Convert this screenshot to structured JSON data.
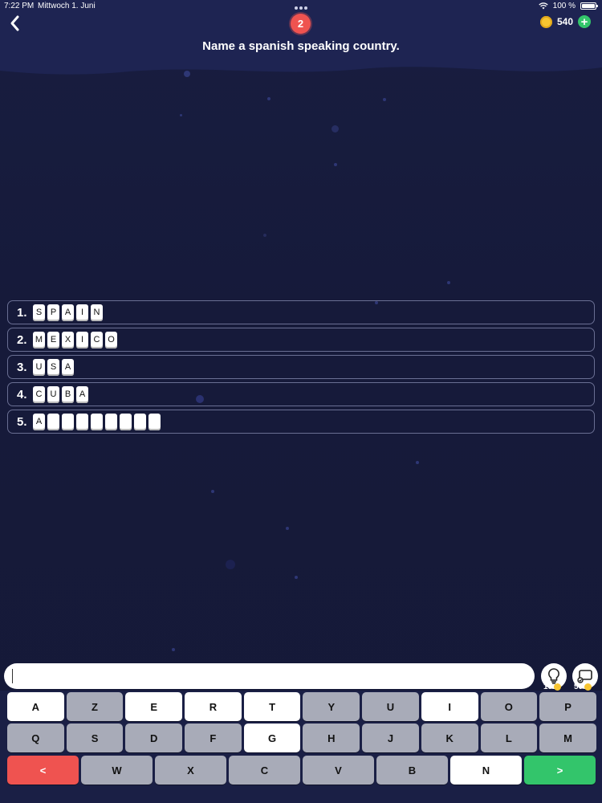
{
  "status": {
    "time": "7:22 PM",
    "date": "Mittwoch 1. Juni",
    "battery": "100 %"
  },
  "header": {
    "level": "2",
    "coins": "540",
    "question": "Name a spanish speaking country."
  },
  "answers": [
    {
      "num": "1.",
      "letters": [
        "S",
        "P",
        "A",
        "I",
        "N"
      ]
    },
    {
      "num": "2.",
      "letters": [
        "M",
        "E",
        "X",
        "I",
        "C",
        "O"
      ]
    },
    {
      "num": "3.",
      "letters": [
        "U",
        "S",
        "A"
      ]
    },
    {
      "num": "4.",
      "letters": [
        "C",
        "U",
        "B",
        "A"
      ]
    },
    {
      "num": "5.",
      "letters": [
        "A",
        "",
        "",
        "",
        "",
        "",
        "",
        "",
        ""
      ]
    }
  ],
  "input": {
    "value": ""
  },
  "aids": {
    "hint_cost": "10",
    "reveal_cost": "50"
  },
  "keyboard": {
    "row1": [
      {
        "label": "A",
        "state": "available"
      },
      {
        "label": "Z",
        "state": "used"
      },
      {
        "label": "E",
        "state": "available"
      },
      {
        "label": "R",
        "state": "available"
      },
      {
        "label": "T",
        "state": "available"
      },
      {
        "label": "Y",
        "state": "used"
      },
      {
        "label": "U",
        "state": "used"
      },
      {
        "label": "I",
        "state": "available"
      },
      {
        "label": "O",
        "state": "used"
      },
      {
        "label": "P",
        "state": "used"
      }
    ],
    "row2": [
      {
        "label": "Q",
        "state": "used"
      },
      {
        "label": "S",
        "state": "used"
      },
      {
        "label": "D",
        "state": "used"
      },
      {
        "label": "F",
        "state": "used"
      },
      {
        "label": "G",
        "state": "available"
      },
      {
        "label": "H",
        "state": "used"
      },
      {
        "label": "J",
        "state": "used"
      },
      {
        "label": "K",
        "state": "used"
      },
      {
        "label": "L",
        "state": "used"
      },
      {
        "label": "M",
        "state": "used"
      }
    ],
    "row3": [
      {
        "label": "W",
        "state": "used"
      },
      {
        "label": "X",
        "state": "used"
      },
      {
        "label": "C",
        "state": "used"
      },
      {
        "label": "V",
        "state": "used"
      },
      {
        "label": "B",
        "state": "used"
      },
      {
        "label": "N",
        "state": "available"
      }
    ],
    "delete_label": "<",
    "submit_label": ">"
  },
  "colors": {
    "background": "#161a3a",
    "accent_red": "#ef5350",
    "accent_green": "#33c56b",
    "coin": "#f7c531"
  }
}
